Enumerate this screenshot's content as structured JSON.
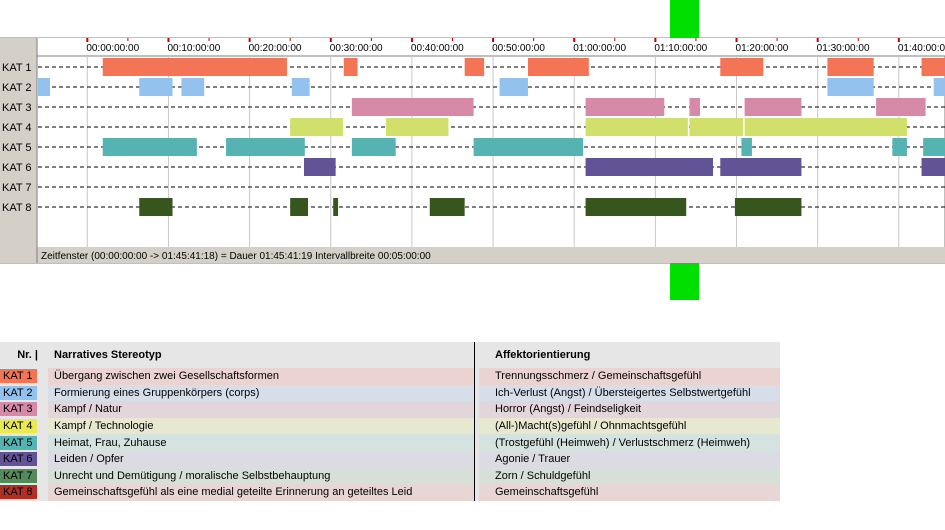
{
  "chart_data": {
    "type": "timeline",
    "x_unit": "minutes",
    "x_start": 0,
    "x_end": 105.69,
    "visible_range_minutes": [
      -6.2,
      105.69
    ],
    "tick_interval_minutes": 10,
    "ticks": [
      {
        "value": 0,
        "label": "00:00:00:00"
      },
      {
        "value": 10,
        "label": "00:10:00:00"
      },
      {
        "value": 20,
        "label": "00:20:00:00"
      },
      {
        "value": 30,
        "label": "00:30:00:00"
      },
      {
        "value": 40,
        "label": "00:40:00:00"
      },
      {
        "value": 50,
        "label": "00:50:00:00"
      },
      {
        "value": 60,
        "label": "01:00:00:00"
      },
      {
        "value": 70,
        "label": "01:10:00:00"
      },
      {
        "value": 80,
        "label": "01:20:00:00"
      },
      {
        "value": 90,
        "label": "01:30:00:00"
      },
      {
        "value": 100,
        "label": "01:40:00:00"
      }
    ],
    "rows": [
      {
        "label": "KAT 1",
        "color": "#f47456",
        "segments": [
          [
            1.9,
            24.6
          ],
          [
            31.6,
            33.3
          ],
          [
            46.5,
            48.9
          ],
          [
            54.3,
            61.8
          ],
          [
            78.0,
            83.3
          ],
          [
            91.2,
            96.9
          ],
          [
            102.8,
            105.7
          ]
        ]
      },
      {
        "label": "KAT 2",
        "color": "#93c2ee",
        "segments": [
          [
            -6.2,
            -4.6
          ],
          [
            6.4,
            10.5
          ],
          [
            11.6,
            14.4
          ],
          [
            25.2,
            27.4
          ],
          [
            50.8,
            54.3
          ],
          [
            91.2,
            96.9
          ],
          [
            104.3,
            105.7
          ]
        ]
      },
      {
        "label": "KAT 3",
        "color": "#d68aa8",
        "segments": [
          [
            32.6,
            47.6
          ],
          [
            61.4,
            71.1
          ],
          [
            74.2,
            75.5
          ],
          [
            81.0,
            88.0
          ],
          [
            97.2,
            103.3
          ]
        ]
      },
      {
        "label": "KAT 4",
        "color": "#d1e06a",
        "segments": [
          [
            25.0,
            31.5
          ],
          [
            36.8,
            44.5
          ],
          [
            61.4,
            74.0
          ],
          [
            74.2,
            80.8
          ],
          [
            81.0,
            101.0
          ]
        ]
      },
      {
        "label": "KAT 5",
        "color": "#55b4b1",
        "segments": [
          [
            1.9,
            13.5
          ],
          [
            17.1,
            26.8
          ],
          [
            32.6,
            38.0
          ],
          [
            47.6,
            61.1
          ],
          [
            80.6,
            81.9
          ],
          [
            99.2,
            101.0
          ],
          [
            103.0,
            105.7
          ]
        ]
      },
      {
        "label": "KAT 6",
        "color": "#615395",
        "segments": [
          [
            26.7,
            30.6
          ],
          [
            61.4,
            77.1
          ],
          [
            78.0,
            81.4
          ],
          [
            81.0,
            88.0
          ],
          [
            102.8,
            105.7
          ]
        ]
      },
      {
        "label": "KAT 7",
        "color": "#548b5a",
        "segments": []
      },
      {
        "label": "KAT 8",
        "color": "#36561d",
        "segments": [
          [
            6.4,
            10.5
          ],
          [
            25.0,
            27.2
          ],
          [
            30.3,
            30.9
          ],
          [
            42.2,
            46.5
          ],
          [
            61.4,
            73.8
          ],
          [
            79.8,
            81.8
          ],
          [
            81.0,
            88.0
          ]
        ]
      }
    ],
    "status_text": "Zeitfenster (00:00:00:00 -> 01:45:41:18) = Dauer 01:45:41:19    Intervallbreite 00:05:00:00"
  },
  "legend": {
    "headers": {
      "nr": "Nr. |",
      "stereotyp": "Narratives Stereotyp",
      "affekt": "Affektorientierung"
    },
    "rows": [
      {
        "kat": "KAT 1",
        "color": "#f47456",
        "tint": "#ead3d0",
        "stereotyp": "Übergang zwischen zwei Gesellschaftsformen",
        "affekt": "Trennungsschmerz / Gemeinschaftsgefühl"
      },
      {
        "kat": "KAT 2",
        "color": "#93c2ee",
        "tint": "#d6dfe9",
        "stereotyp": "Formierung eines Gruppenkörpers (corps)",
        "affekt": "Ich-Verlust (Angst) / Übersteigertes Selbstwertgefühl"
      },
      {
        "kat": "KAT 3",
        "color": "#d68aa8",
        "tint": "#e3d6db",
        "stereotyp": "Kampf / Natur",
        "affekt": "Horror (Angst) / Feindseligkeit"
      },
      {
        "kat": "KAT 4",
        "color": "#eaea4e",
        "tint": "#e7e8d0",
        "stereotyp": "Kampf / Technologie",
        "affekt": "(All-)Macht(s)gefühl / Ohnmachtsgefühl"
      },
      {
        "kat": "KAT 5",
        "color": "#55b4b1",
        "tint": "#d4e2e0",
        "stereotyp": "Heimat, Frau, Zuhause",
        "affekt": "(Trostgefühl (Heimweh) / Verlustschmerz (Heimweh)"
      },
      {
        "kat": "KAT 6",
        "color": "#615395",
        "tint": "#dcdae3",
        "stereotyp": "Leiden / Opfer",
        "affekt": "Agonie / Trauer"
      },
      {
        "kat": "KAT 7",
        "color": "#548b5a",
        "tint": "#d7e0d7",
        "stereotyp": "Unrecht und Demütigung / moralische Selbstbehauptung",
        "affekt": "Zorn / Schuldgefühl"
      },
      {
        "kat": "KAT 8",
        "color": "#b03025",
        "tint": "#e7d6d4",
        "stereotyp": "Gemeinschaftsgefühl als eine medial geteilte Erinnerung an geteiltes Leid",
        "affekt": "Gemeinschaftsgefühl"
      }
    ]
  }
}
